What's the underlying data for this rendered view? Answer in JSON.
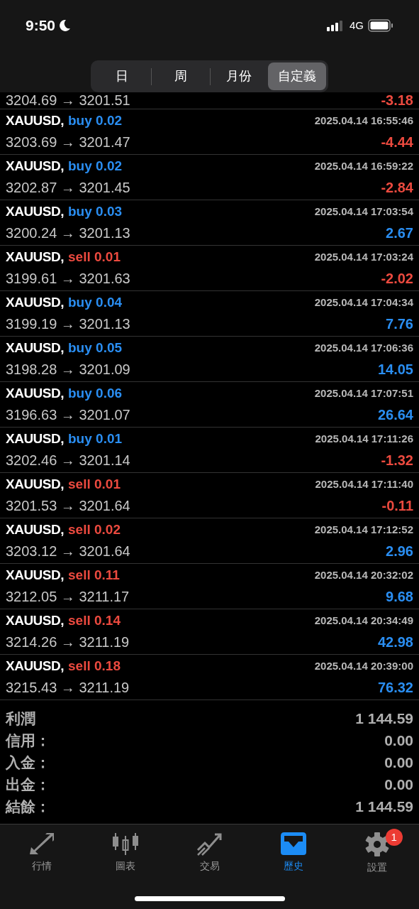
{
  "status_bar": {
    "time": "9:50",
    "network": "4G"
  },
  "period_tabs": [
    {
      "label": "日",
      "selected": false
    },
    {
      "label": "周",
      "selected": false
    },
    {
      "label": "月份",
      "selected": false
    },
    {
      "label": "自定義",
      "selected": true
    }
  ],
  "partial_deal": {
    "prices": "3204.69 → 3201.51",
    "profit": {
      "text": "-3.18",
      "color": "#ec4a3f"
    }
  },
  "deals": [
    {
      "symbol": "XAUUSD,",
      "kind": "buy",
      "volume": "buy 0.02",
      "time": "2025.04.14 16:55:46",
      "prices": "3203.69 → 3201.47",
      "profit": {
        "text": "-4.44",
        "color": "#ec4a3f"
      }
    },
    {
      "symbol": "XAUUSD,",
      "kind": "buy",
      "volume": "buy 0.02",
      "time": "2025.04.14 16:59:22",
      "prices": "3202.87 → 3201.45",
      "profit": {
        "text": "-2.84",
        "color": "#ec4a3f"
      }
    },
    {
      "symbol": "XAUUSD,",
      "kind": "buy",
      "volume": "buy 0.03",
      "time": "2025.04.14 17:03:54",
      "prices": "3200.24 → 3201.13",
      "profit": {
        "text": "2.67",
        "color": "#2a8ef2"
      }
    },
    {
      "symbol": "XAUUSD,",
      "kind": "sell",
      "volume": "sell 0.01",
      "time": "2025.04.14 17:03:24",
      "prices": "3199.61 → 3201.63",
      "profit": {
        "text": "-2.02",
        "color": "#ec4a3f"
      }
    },
    {
      "symbol": "XAUUSD,",
      "kind": "buy",
      "volume": "buy 0.04",
      "time": "2025.04.14 17:04:34",
      "prices": "3199.19 → 3201.13",
      "profit": {
        "text": "7.76",
        "color": "#2a8ef2"
      }
    },
    {
      "symbol": "XAUUSD,",
      "kind": "buy",
      "volume": "buy 0.05",
      "time": "2025.04.14 17:06:36",
      "prices": "3198.28 → 3201.09",
      "profit": {
        "text": "14.05",
        "color": "#2a8ef2"
      }
    },
    {
      "symbol": "XAUUSD,",
      "kind": "buy",
      "volume": "buy 0.06",
      "time": "2025.04.14 17:07:51",
      "prices": "3196.63 → 3201.07",
      "profit": {
        "text": "26.64",
        "color": "#2a8ef2"
      }
    },
    {
      "symbol": "XAUUSD,",
      "kind": "buy",
      "volume": "buy 0.01",
      "time": "2025.04.14 17:11:26",
      "prices": "3202.46 → 3201.14",
      "profit": {
        "text": "-1.32",
        "color": "#ec4a3f"
      }
    },
    {
      "symbol": "XAUUSD,",
      "kind": "sell",
      "volume": "sell 0.01",
      "time": "2025.04.14 17:11:40",
      "prices": "3201.53 → 3201.64",
      "profit": {
        "text": "-0.11",
        "color": "#ec4a3f"
      }
    },
    {
      "symbol": "XAUUSD,",
      "kind": "sell",
      "volume": "sell 0.02",
      "time": "2025.04.14 17:12:52",
      "prices": "3203.12 → 3201.64",
      "profit": {
        "text": "2.96",
        "color": "#2a8ef2"
      }
    },
    {
      "symbol": "XAUUSD,",
      "kind": "sell",
      "volume": "sell 0.11",
      "time": "2025.04.14 20:32:02",
      "prices": "3212.05 → 3211.17",
      "profit": {
        "text": "9.68",
        "color": "#2a8ef2"
      }
    },
    {
      "symbol": "XAUUSD,",
      "kind": "sell",
      "volume": "sell 0.14",
      "time": "2025.04.14 20:34:49",
      "prices": "3214.26 → 3211.19",
      "profit": {
        "text": "42.98",
        "color": "#2a8ef2"
      }
    },
    {
      "symbol": "XAUUSD,",
      "kind": "sell",
      "volume": "sell 0.18",
      "time": "2025.04.14 20:39:00",
      "prices": "3215.43 → 3211.19",
      "profit": {
        "text": "76.32",
        "color": "#2a8ef2"
      }
    }
  ],
  "summary": [
    {
      "label": "利潤",
      "value": "1 144.59"
    },
    {
      "label": "信用：",
      "value": "0.00"
    },
    {
      "label": "入金：",
      "value": "0.00"
    },
    {
      "label": "出金：",
      "value": "0.00"
    },
    {
      "label": "結餘：",
      "value": "1 144.59"
    }
  ],
  "tab_bar": [
    {
      "kind": "quotes",
      "label": "行情",
      "selected": false
    },
    {
      "kind": "chart",
      "label": "圖表",
      "selected": false
    },
    {
      "kind": "trade",
      "label": "交易",
      "selected": false
    },
    {
      "kind": "history",
      "label": "歷史",
      "selected": true
    },
    {
      "kind": "settings",
      "label": "設置",
      "selected": false,
      "badge": "1"
    }
  ]
}
